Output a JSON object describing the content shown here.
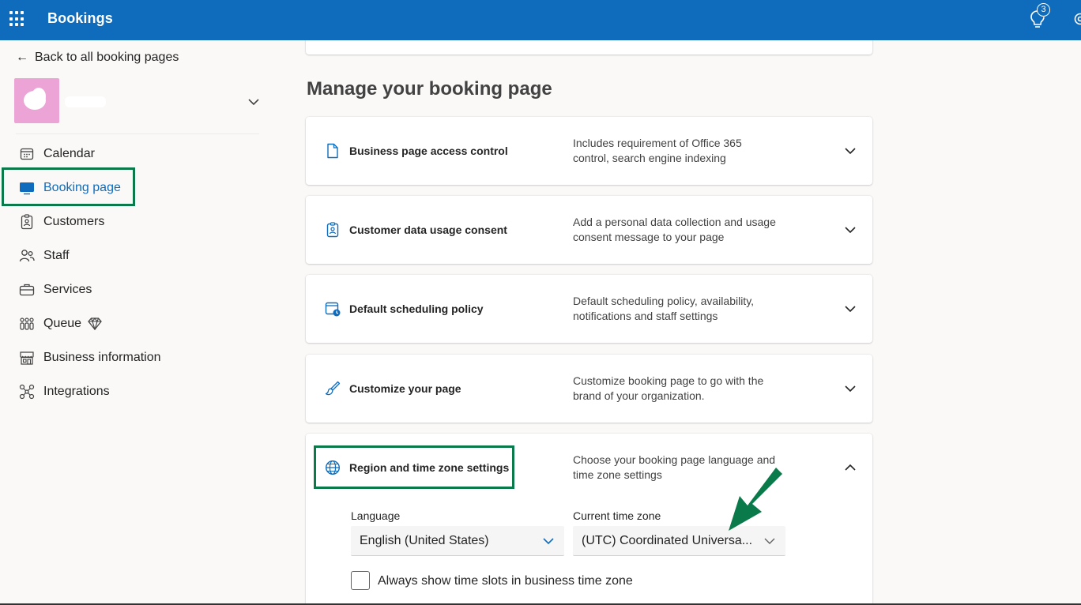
{
  "app": {
    "title": "Bookings"
  },
  "header": {
    "tips_badge": "3"
  },
  "sidebar": {
    "back_label": "Back to all booking pages",
    "items": [
      {
        "label": "Calendar",
        "icon": "calendar-icon"
      },
      {
        "label": "Booking page",
        "icon": "booking-page-icon",
        "active": true
      },
      {
        "label": "Customers",
        "icon": "customers-icon"
      },
      {
        "label": "Staff",
        "icon": "staff-icon"
      },
      {
        "label": "Services",
        "icon": "briefcase-icon"
      },
      {
        "label": "Queue",
        "icon": "queue-icon",
        "premium": true
      },
      {
        "label": "Business information",
        "icon": "storefront-icon"
      },
      {
        "label": "Integrations",
        "icon": "integrations-icon"
      }
    ]
  },
  "main": {
    "section_title": "Manage your booking page",
    "cards": [
      {
        "title": "Business page access control",
        "description": "Includes requirement of Office 365 control, search engine indexing",
        "icon": "document-icon"
      },
      {
        "title": "Customer data usage consent",
        "description": "Add a personal data collection and usage consent message to your page",
        "icon": "id-badge-icon"
      },
      {
        "title": "Default scheduling policy",
        "description": "Default scheduling policy, availability, notifications and staff settings",
        "icon": "calendar-clock-icon"
      },
      {
        "title": "Customize your page",
        "description": "Customize booking page to go with the brand of your organization.",
        "icon": "paintbrush-icon"
      },
      {
        "title": "Region and time zone settings",
        "description": "Choose your booking page language and time zone settings",
        "icon": "globe-icon"
      }
    ],
    "region": {
      "language_label": "Language",
      "language_value": "English (United States)",
      "timezone_label": "Current time zone",
      "timezone_value": "(UTC) Coordinated Universa...",
      "checkbox_label": "Always show time slots in business time zone",
      "checkbox_checked": false
    }
  },
  "colors": {
    "brand": "#0f6cbd",
    "annotation": "#0a7a4a",
    "avatar": "#eca3d5"
  }
}
